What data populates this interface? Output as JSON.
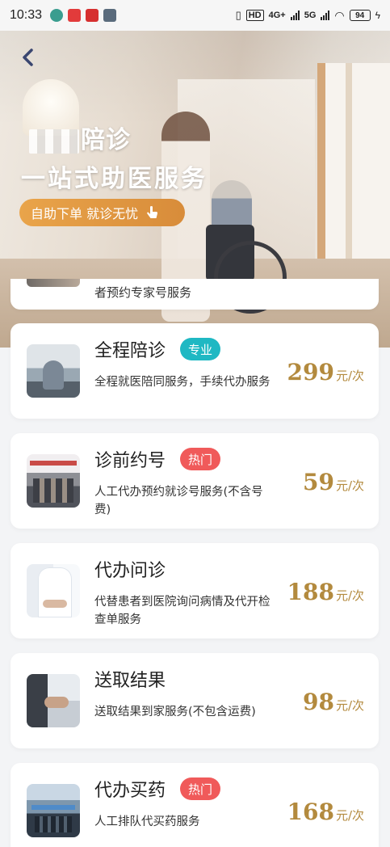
{
  "status_bar": {
    "time": "10:33",
    "app_icons": [
      {
        "name": "clover-app-icon",
        "color": "#3a9d8f"
      },
      {
        "name": "red-app-icon",
        "color": "#e23b3b"
      },
      {
        "name": "red-app-icon-2",
        "color": "#d62f2f"
      },
      {
        "name": "k-app-icon",
        "color": "#5a6b7c"
      }
    ],
    "hd": "HD",
    "net_4g": "4G+",
    "net_5g": "5G",
    "battery": "94"
  },
  "hero": {
    "brand_suffix": "陪诊",
    "subtitle": "一站式助医服务",
    "pill_text": "自助下单 就诊无忧",
    "pill_color": "#e29a45"
  },
  "partial_card": {
    "desc": "者预约专家号服务"
  },
  "services": [
    {
      "title": "全程陪诊",
      "tag": "专业",
      "tag_color": "#1fb8c3",
      "desc": "全程就医陪同服务，手续代办服务",
      "price": "299",
      "unit": "元/次",
      "thumb": "wheelchair-photo"
    },
    {
      "title": "诊前约号",
      "tag": "热门",
      "tag_color": "#f05a5a",
      "desc": "人工代办预约就诊号服务(不含号费)",
      "price": "59",
      "unit": "元/次",
      "thumb": "hospital-hall-photo"
    },
    {
      "title": "代办问诊",
      "tag": "",
      "tag_color": "",
      "desc": "代替患者到医院询问病情及代开检查单服务",
      "price": "188",
      "unit": "元/次",
      "thumb": "doctor-photo"
    },
    {
      "title": "送取结果",
      "tag": "",
      "tag_color": "",
      "desc": "送取结果到家服务(不包含运费)",
      "price": "98",
      "unit": "元/次",
      "thumb": "handover-photo"
    },
    {
      "title": "代办买药",
      "tag": "热门",
      "tag_color": "#f05a5a",
      "desc": "人工排队代买药服务",
      "price": "168",
      "unit": "元/次",
      "thumb": "pharmacy-photo"
    }
  ],
  "colors": {
    "price": "#b38a3e",
    "background": "#f3f4f6"
  }
}
